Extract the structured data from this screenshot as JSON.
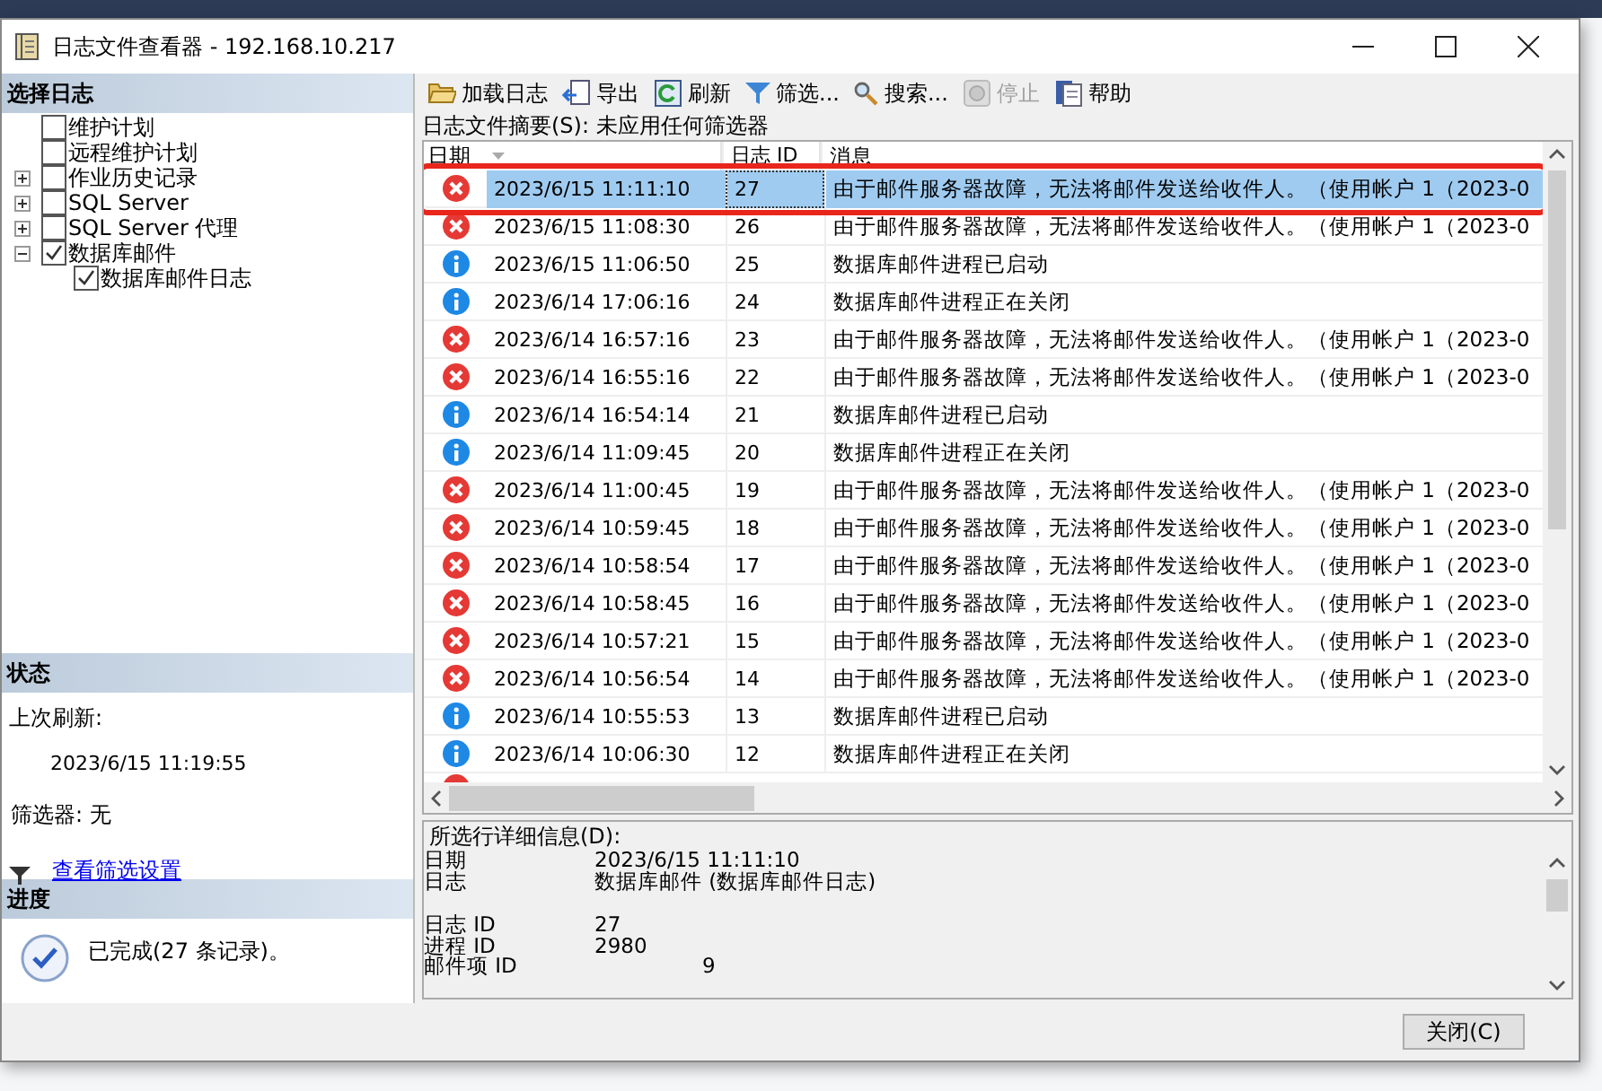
{
  "window": {
    "title": "日志文件查看器 - 192.168.10.217"
  },
  "left_panel": {
    "select_log": {
      "title": "选择日志",
      "tree": [
        {
          "label": "维护计划",
          "checked": false
        },
        {
          "label": "远程维护计划",
          "checked": false
        },
        {
          "label": "作业历史记录",
          "checked": false,
          "expanded": false
        },
        {
          "label": "SQL Server",
          "checked": false,
          "expanded": false
        },
        {
          "label": "SQL Server 代理",
          "checked": false,
          "expanded": false
        },
        {
          "label": "数据库邮件",
          "checked": true,
          "expanded": true,
          "children": [
            {
              "label": "数据库邮件日志",
              "checked": true
            }
          ]
        }
      ]
    },
    "status": {
      "title": "状态",
      "last_refresh_label": "上次刷新:",
      "last_refresh_value": "2023/6/15 11:19:55",
      "filter": "筛选器: 无",
      "filter_link": "查看筛选设置"
    },
    "progress": {
      "title": "进度",
      "message": "已完成(27 条记录)。"
    }
  },
  "toolbar": [
    {
      "label": "加载日志",
      "kind": "folder",
      "disabled": false
    },
    {
      "label": "导出",
      "kind": "export",
      "disabled": false
    },
    {
      "label": "刷新",
      "kind": "refresh",
      "disabled": false
    },
    {
      "label": "筛选...",
      "kind": "filter",
      "disabled": false
    },
    {
      "label": "搜索...",
      "kind": "search",
      "disabled": false
    },
    {
      "label": "停止",
      "kind": "stop",
      "disabled": true
    },
    {
      "label": "帮助",
      "kind": "help",
      "disabled": false
    }
  ],
  "summary": "日志文件摘要(S): 未应用任何筛选器",
  "table": {
    "columns": [
      "日期",
      "日志 ID",
      "消息"
    ],
    "rows": [
      {
        "kind": "error",
        "date": "2023/6/15 11:11:10",
        "id": "27",
        "message": "由于邮件服务器故障，无法将邮件发送给收件人。（使用帐户 1（2023-0",
        "selected": true,
        "outlined": true
      },
      {
        "kind": "error",
        "date": "2023/6/15 11:08:30",
        "id": "26",
        "message": "由于邮件服务器故障，无法将邮件发送给收件人。（使用帐户 1（2023-0",
        "selected": false,
        "outlined": false
      },
      {
        "kind": "info",
        "date": "2023/6/15 11:06:50",
        "id": "25",
        "message": "数据库邮件进程已启动",
        "selected": false,
        "outlined": false
      },
      {
        "kind": "info",
        "date": "2023/6/14 17:06:16",
        "id": "24",
        "message": "数据库邮件进程正在关闭",
        "selected": false,
        "outlined": false
      },
      {
        "kind": "error",
        "date": "2023/6/14 16:57:16",
        "id": "23",
        "message": "由于邮件服务器故障，无法将邮件发送给收件人。（使用帐户 1（2023-0",
        "selected": false,
        "outlined": false
      },
      {
        "kind": "error",
        "date": "2023/6/14 16:55:16",
        "id": "22",
        "message": "由于邮件服务器故障，无法将邮件发送给收件人。（使用帐户 1（2023-0",
        "selected": false,
        "outlined": false
      },
      {
        "kind": "info",
        "date": "2023/6/14 16:54:14",
        "id": "21",
        "message": "数据库邮件进程已启动",
        "selected": false,
        "outlined": false
      },
      {
        "kind": "info",
        "date": "2023/6/14 11:09:45",
        "id": "20",
        "message": "数据库邮件进程正在关闭",
        "selected": false,
        "outlined": false
      },
      {
        "kind": "error",
        "date": "2023/6/14 11:00:45",
        "id": "19",
        "message": "由于邮件服务器故障，无法将邮件发送给收件人。（使用帐户 1（2023-0",
        "selected": false,
        "outlined": false
      },
      {
        "kind": "error",
        "date": "2023/6/14 10:59:45",
        "id": "18",
        "message": "由于邮件服务器故障，无法将邮件发送给收件人。（使用帐户 1（2023-0",
        "selected": false,
        "outlined": false
      },
      {
        "kind": "error",
        "date": "2023/6/14 10:58:54",
        "id": "17",
        "message": "由于邮件服务器故障，无法将邮件发送给收件人。（使用帐户 1（2023-0",
        "selected": false,
        "outlined": false
      },
      {
        "kind": "error",
        "date": "2023/6/14 10:58:45",
        "id": "16",
        "message": "由于邮件服务器故障，无法将邮件发送给收件人。（使用帐户 1（2023-0",
        "selected": false,
        "outlined": false
      },
      {
        "kind": "error",
        "date": "2023/6/14 10:57:21",
        "id": "15",
        "message": "由于邮件服务器故障，无法将邮件发送给收件人。（使用帐户 1（2023-0",
        "selected": false,
        "outlined": false
      },
      {
        "kind": "error",
        "date": "2023/6/14 10:56:54",
        "id": "14",
        "message": "由于邮件服务器故障，无法将邮件发送给收件人。（使用帐户 1（2023-0",
        "selected": false,
        "outlined": false
      },
      {
        "kind": "info",
        "date": "2023/6/14 10:55:53",
        "id": "13",
        "message": "数据库邮件进程已启动",
        "selected": false,
        "outlined": false
      },
      {
        "kind": "info",
        "date": "2023/6/14 10:06:30",
        "id": "12",
        "message": "数据库邮件进程正在关闭",
        "selected": false,
        "outlined": false
      }
    ]
  },
  "details": {
    "title": "所选行详细信息(D):",
    "rows": [
      {
        "label": "日期",
        "value": "2023/6/15 11:11:10"
      },
      {
        "label": "日志",
        "value": "数据库邮件 (数据库邮件日志)"
      },
      {
        "label": "日志 ID",
        "value": "27",
        "gap": true
      },
      {
        "label": "进程 ID",
        "value": "2980"
      },
      {
        "label": "邮件项 ID",
        "value": "9",
        "wide": true
      }
    ]
  },
  "close_button": "关闭(C)"
}
